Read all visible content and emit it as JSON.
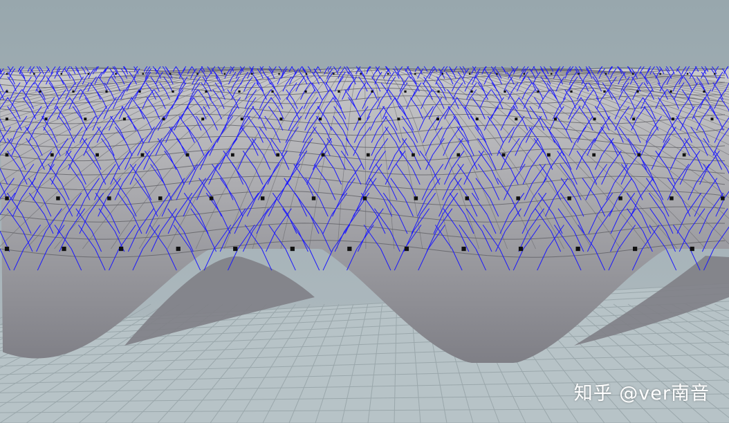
{
  "viewport": {
    "sky_top_color": "#98a7ad",
    "sky_bottom_color": "#b2bdc2",
    "floor_color": "#b7c3c7",
    "floor_grid_color": "#9aa7ab",
    "surface_light_color": "#c9c9cb",
    "surface_shade_color": "#7f7f86",
    "wire_color": "#5f5f64",
    "normals_color": "#1a16ff",
    "point_color": "#111111"
  },
  "watermark": {
    "text": "知乎 @ver南音"
  }
}
